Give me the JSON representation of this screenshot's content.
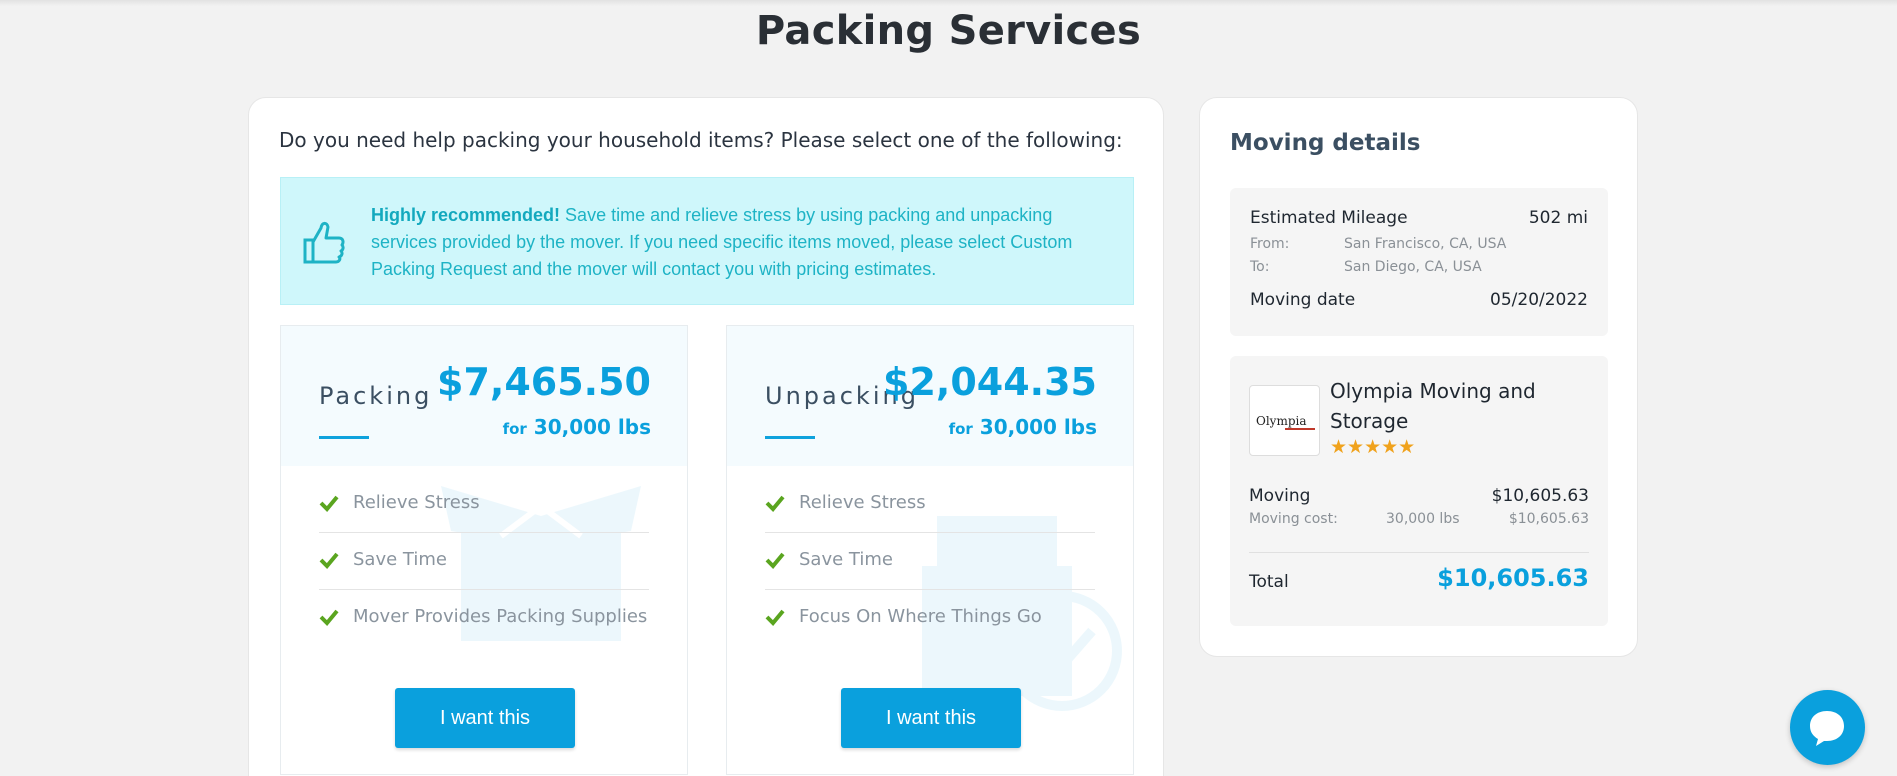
{
  "page": {
    "title": "Packing Services"
  },
  "main": {
    "question": "Do you need help packing your household items? Please select one of the following:",
    "recommend": {
      "bold": "Highly recommended!",
      "text": " Save time and relieve stress by using packing and unpacking services provided by the mover. If you need specific items moved, please select Custom Packing Request and the mover will contact you with pricing estimates."
    },
    "services": [
      {
        "name": "Packing",
        "price": "$7,465.50",
        "for_label": "for",
        "weight": "30,000 lbs",
        "features": [
          "Relieve Stress",
          "Save Time",
          "Mover Provides Packing Supplies"
        ],
        "button": "I want this"
      },
      {
        "name": "Unpacking",
        "price": "$2,044.35",
        "for_label": "for",
        "weight": "30,000 lbs",
        "features": [
          "Relieve Stress",
          "Save Time",
          "Focus On Where Things Go"
        ],
        "button": "I want this"
      }
    ]
  },
  "details": {
    "title": "Moving details",
    "mileage_label": "Estimated Mileage",
    "mileage_value": "502 mi",
    "from_label": "From:",
    "from_value": "San Francisco, CA, USA",
    "to_label": "To:",
    "to_value": "San Diego, CA, USA",
    "date_label": "Moving date",
    "date_value": "05/20/2022",
    "mover": {
      "logo_text": "Olympia",
      "name": "Olympia Moving and Storage",
      "stars": "★★★★★",
      "rating": 5
    },
    "moving_label": "Moving",
    "moving_value": "$10,605.63",
    "cost_label": "Moving cost:",
    "cost_weight": "30,000 lbs",
    "cost_value": "$10,605.63",
    "total_label": "Total",
    "total_value": "$10,605.63"
  },
  "colors": {
    "accent": "#0aa0dd",
    "recommend_bg": "#cff7fb",
    "check": "#5aa51f",
    "star": "#f0a21c"
  },
  "icons": [
    "thumbs-up-icon",
    "check-icon",
    "chat-icon"
  ]
}
